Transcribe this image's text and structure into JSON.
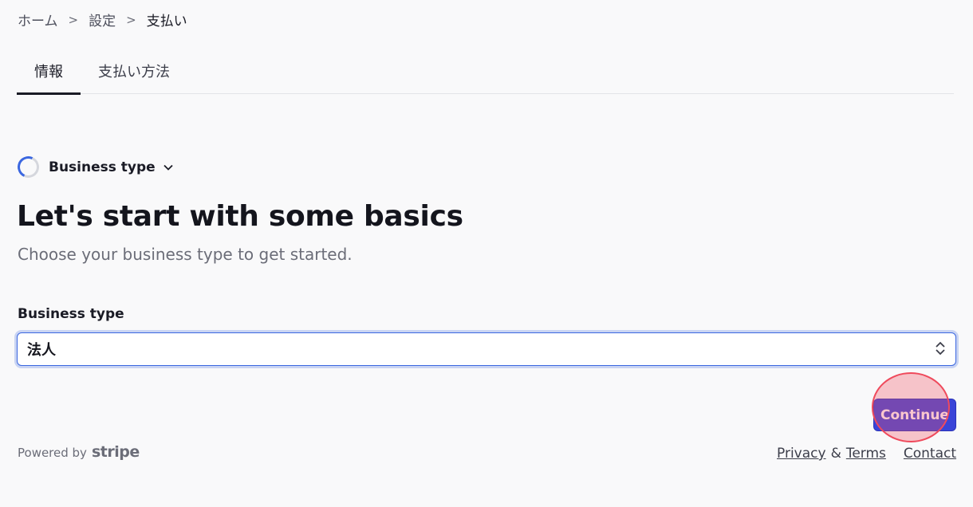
{
  "breadcrumb": {
    "items": [
      "ホーム",
      "設定",
      "支払い"
    ],
    "separator": ">"
  },
  "tabs": [
    {
      "label": "情報",
      "active": true
    },
    {
      "label": "支払い方法",
      "active": false
    }
  ],
  "step": {
    "label": "Business type",
    "chevron_icon": "chevron-down-icon",
    "status_icon": "progress-spinner-icon"
  },
  "main": {
    "heading": "Let's start with some basics",
    "subtext": "Choose your business type to get started."
  },
  "form": {
    "business_type_label": "Business type",
    "business_type_value": "法人",
    "select_icon": "up-down-chevron-icon"
  },
  "actions": {
    "continue_label": "Continue"
  },
  "footer": {
    "powered_by": "Powered by",
    "brand": "stripe",
    "privacy": "Privacy",
    "amp": "&",
    "terms": "Terms",
    "contact": "Contact"
  },
  "colors": {
    "accent": "#3a44d8",
    "focus": "#3b67e0",
    "background": "#f9f9fa"
  }
}
